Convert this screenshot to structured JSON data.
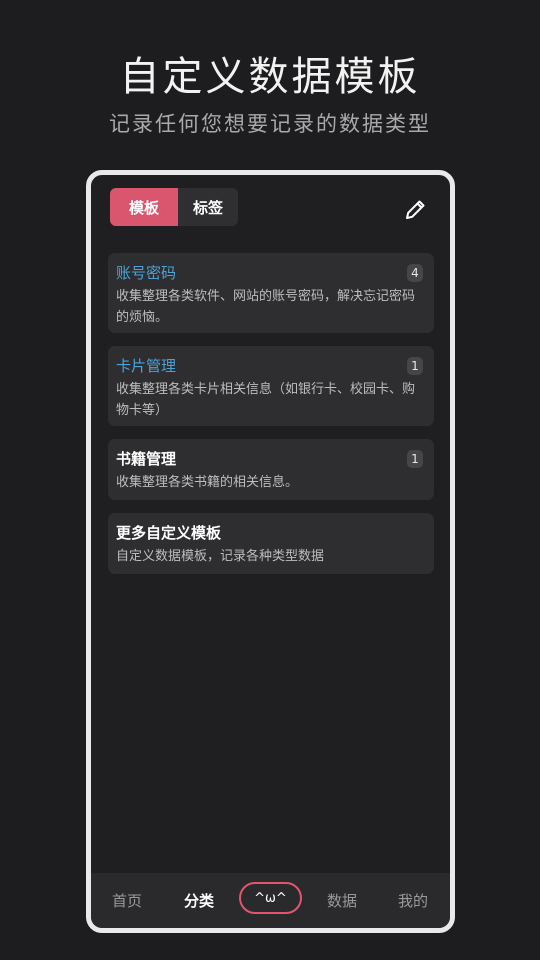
{
  "hero": {
    "title": "自定义数据模板",
    "subtitle": "记录任何您想要记录的数据类型"
  },
  "tabs": {
    "active_label": "模板",
    "inactive_label": "标签"
  },
  "toolbar": {
    "edit_icon": "pencil-icon"
  },
  "cards": [
    {
      "title": "账号密码",
      "desc": "收集整理各类软件、网站的账号密码，解决忘记密码的烦恼。",
      "count": "4"
    },
    {
      "title": "卡片管理",
      "desc": "收集整理各类卡片相关信息（如银行卡、校园卡、购物卡等）",
      "count": "1"
    },
    {
      "title": "书籍管理",
      "desc": "收集整理各类书籍的相关信息。",
      "count": "1"
    },
    {
      "title": "更多自定义模板",
      "desc": "自定义数据模板，记录各种类型数据"
    }
  ],
  "nav": {
    "home": "首页",
    "category": "分类",
    "center": "^ω^",
    "data": "数据",
    "mine": "我的"
  },
  "colors": {
    "accent": "#d9566e",
    "link_blue": "#4aa3d9",
    "background": "#1d1d1f",
    "card": "#2e2e30"
  }
}
